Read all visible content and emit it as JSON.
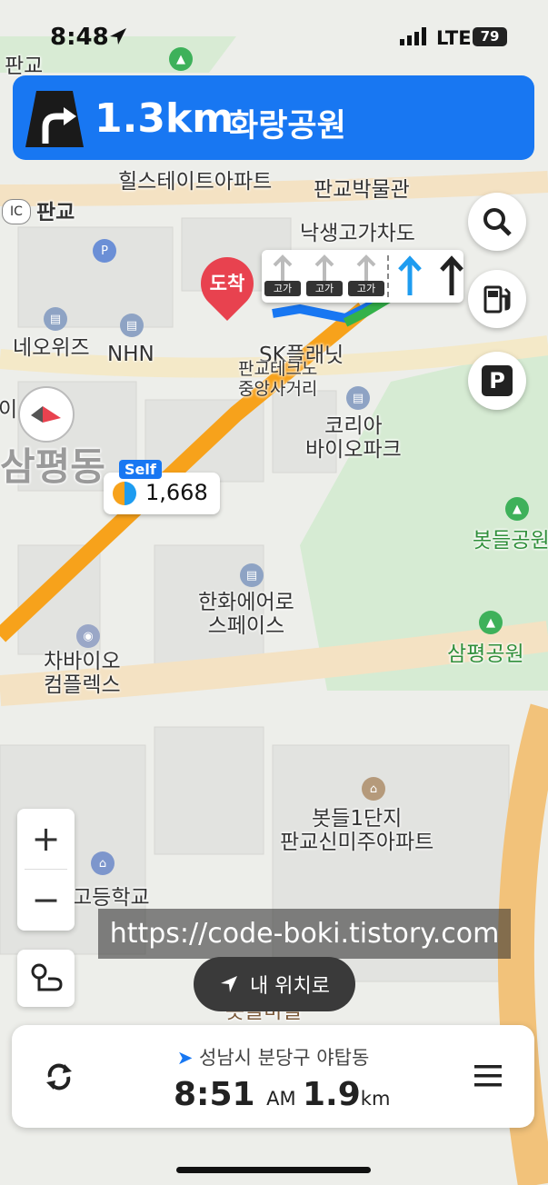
{
  "status": {
    "time": "8:48",
    "network": "LTE",
    "battery": "79"
  },
  "navigation": {
    "distance": "1.3km",
    "destination": "화랑공원"
  },
  "lanes": [
    {
      "tag": "고가",
      "active": false,
      "icon": "straight-arrow-icon"
    },
    {
      "tag": "고가",
      "active": false,
      "icon": "straight-arrow-icon"
    },
    {
      "tag": "고가",
      "active": false,
      "icon": "straight-arrow-icon"
    },
    {
      "tag": "",
      "active": true,
      "icon": "straight-arrow-icon"
    },
    {
      "tag": "",
      "active": false,
      "icon": "straight-arrow-icon"
    }
  ],
  "marker": {
    "label": "도착"
  },
  "gas_station": {
    "badge": "Self",
    "price": "1,668"
  },
  "map_labels": {
    "pangyo_top": "판교",
    "hillstate": "힐스테이트아파트",
    "pangyo_museum": "판교박물관",
    "ic": "IC",
    "pangyo_ic": "판교",
    "naksaeng": "낙생고가차도",
    "neowiz": "네오위즈",
    "nhn": "NHN",
    "sk_planet": "SK플래닛",
    "junction": "판교테크노\n중앙사거리",
    "korea_bio": "코리아\n바이오파크",
    "sampyeong_dong": "삼평동",
    "bongdeul_park": "봇들공원",
    "hanwha": "한화에어로\n스페이스",
    "sampyeong_park": "삼평공원",
    "cha_bio": "차바이오\n컴플렉스",
    "apartment": "봇들1단지\n판교신미주아파트",
    "highschool": "고등학교",
    "village": "봇들마을",
    "left_i": "이"
  },
  "watermark": "https://code-boki.tistory.com",
  "my_location": {
    "label": "내 위치로"
  },
  "bottom": {
    "address": "성남시 분당구 야탑동",
    "eta": "8:51",
    "ampm": "AM",
    "distance": "1.9",
    "unit": "km"
  },
  "colors": {
    "primary": "#1877f2",
    "route": "#f7a21b",
    "marker": "#e8424f"
  }
}
